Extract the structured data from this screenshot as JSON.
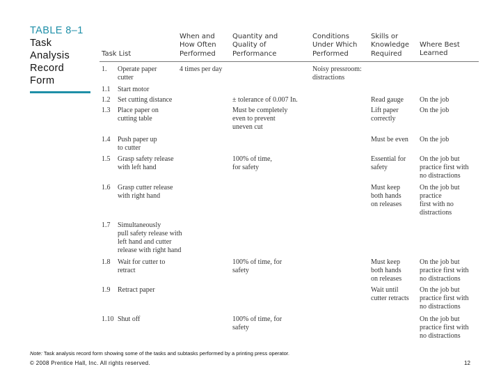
{
  "title": {
    "number": "TABLE 8–1",
    "lines": [
      "Task",
      "Analysis",
      "Record",
      "Form"
    ]
  },
  "accent_color": "#1f8fa8",
  "table": {
    "headers": {
      "task": [
        "Task List"
      ],
      "when": [
        "When and",
        "How Often",
        "Performed"
      ],
      "quantity": [
        "Quantity and",
        "Quality of",
        "Performance"
      ],
      "conditions": [
        "Conditions",
        "Under Which",
        "Performed"
      ],
      "skills": [
        "Skills or",
        "Knowledge",
        "Required"
      ],
      "where": [
        "Where Best",
        "Learned"
      ]
    },
    "rows": [
      {
        "num": "1.",
        "task": [
          "Operate paper",
          "cutter"
        ],
        "when": [
          "4 times per day"
        ],
        "quantity": [],
        "conditions": [
          "Noisy pressroom:",
          "distractions"
        ],
        "skills": [],
        "where": []
      },
      {
        "num": "1.1",
        "task": [
          "Start motor"
        ],
        "when": [],
        "quantity": [],
        "conditions": [],
        "skills": [],
        "where": []
      },
      {
        "num": "1.2",
        "task": [
          "Set cutting distance"
        ],
        "when": [],
        "quantity": [
          "± tolerance of 0.007 In."
        ],
        "conditions": [],
        "skills": [
          "Read gauge"
        ],
        "where": [
          "On the job"
        ]
      },
      {
        "num": "1.3",
        "task": [
          "Place paper on",
          "cutting table"
        ],
        "when": [],
        "quantity": [
          "Must be completely",
          "even to prevent",
          "uneven cut"
        ],
        "conditions": [],
        "skills": [
          "Lift paper",
          "correctly"
        ],
        "where": [
          "On the job"
        ]
      },
      {
        "num": "1.4",
        "task": [
          "Push paper up",
          "to cutter"
        ],
        "when": [],
        "quantity": [],
        "conditions": [],
        "skills": [
          "Must be even"
        ],
        "where": [
          "On the job"
        ]
      },
      {
        "num": "1.5",
        "task": [
          "Grasp safety release",
          "with left hand"
        ],
        "when": [],
        "quantity": [
          "100% of time,",
          "for safety"
        ],
        "conditions": [],
        "skills": [
          "Essential for",
          "safety"
        ],
        "where": [
          "On the job but",
          "practice first with",
          "no distractions"
        ]
      },
      {
        "num": "1.6",
        "task": [
          "Grasp cutter release",
          "with right hand"
        ],
        "when": [],
        "quantity": [],
        "conditions": [],
        "skills": [
          "Must keep",
          "both hands",
          "on releases"
        ],
        "where": [
          "On the job but",
          "practice",
          "first with no",
          "distractions"
        ]
      },
      {
        "num": "1.7",
        "task": [
          "Simultaneously",
          "pull safety release with",
          "left hand and cutter",
          "release with right hand"
        ],
        "when": [],
        "quantity": [],
        "conditions": [],
        "skills": [],
        "where": []
      },
      {
        "num": "1.8",
        "task": [
          "Wait for cutter to",
          "retract"
        ],
        "when": [],
        "quantity": [
          "100% of time, for",
          "safety"
        ],
        "conditions": [],
        "skills": [
          "Must keep",
          "both hands",
          "on releases"
        ],
        "where": [
          "On the job but",
          "practice first with",
          "no distractions"
        ]
      },
      {
        "num": "1.9",
        "task": [
          "Retract paper"
        ],
        "when": [],
        "quantity": [],
        "conditions": [],
        "skills": [
          "Wait until",
          "cutter retracts"
        ],
        "where": [
          "On the job but",
          "practice first with",
          "no distractions"
        ]
      },
      {
        "num": "1.10",
        "task": [
          "Shut off"
        ],
        "when": [],
        "quantity": [
          "100% of time, for",
          "safety"
        ],
        "conditions": [],
        "skills": [],
        "where": [
          "On the job but",
          "practice first with",
          "no distractions"
        ]
      }
    ]
  },
  "footer": {
    "note_label": "Note:",
    "note_text": " Task analysis record form showing some of the tasks and subtasks performed by a printing press operator.",
    "copyright": "© 2008 Prentice Hall, Inc. All rights reserved.",
    "page_number": "12"
  }
}
